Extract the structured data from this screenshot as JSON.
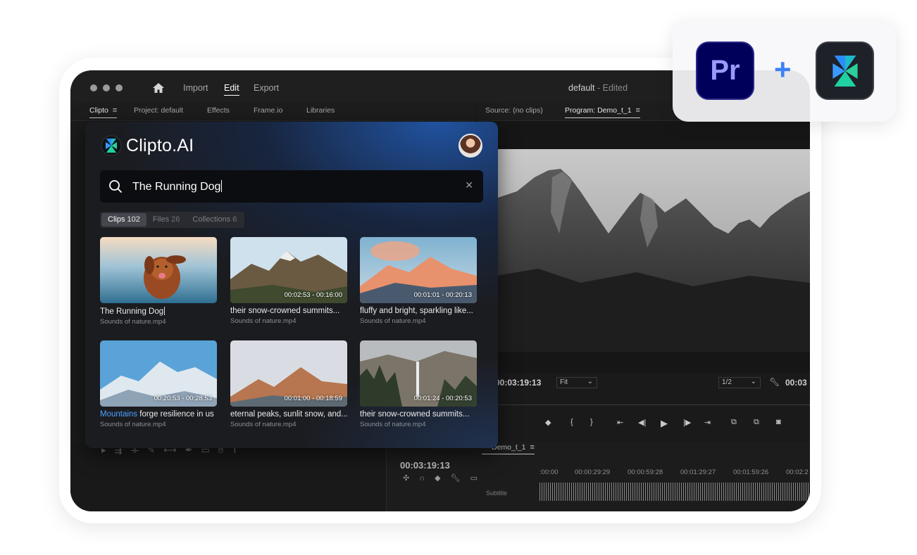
{
  "window": {
    "menu": {
      "import": "Import",
      "edit": "Edit",
      "export": "Export"
    },
    "doc_title": "default",
    "doc_status": " - Edited"
  },
  "panels": {
    "left_tabs": [
      "Clipto",
      "Project: default",
      "Effects",
      "Frame.io",
      "Libraries"
    ],
    "right_tabs": [
      "Source: (no clips)",
      "Program: Demo_t_1"
    ]
  },
  "monitor": {
    "timecode": "00:03:19:13",
    "fit": "Fit",
    "resolution": "1/2",
    "timecode_right": "00:03"
  },
  "timeline": {
    "sequence": "Demo_t_1",
    "timecode": "00:03:19:13",
    "ticks": [
      ":00:00",
      "00:00:29:29",
      "00:00:59:28",
      "00:01:29:27",
      "00:01:59:26",
      "00:02:2"
    ],
    "subtitle_label": "Subtitle"
  },
  "clipto": {
    "brand": "Clipto.AI",
    "search_query": "The Running Dog",
    "tabs": [
      {
        "label": "Clips",
        "count": "102"
      },
      {
        "label": "Files",
        "count": "26"
      },
      {
        "label": "Collections",
        "count": "6"
      }
    ],
    "clips": [
      {
        "title": "The Running Dog",
        "file": "Sounds of nature.mp4",
        "duration": ""
      },
      {
        "title": "their snow-crowned summits...",
        "file": "Sounds of nature.mp4",
        "duration": "00:02:53 - 00:16:00"
      },
      {
        "title": "fluffy and bright, sparkling like...",
        "file": "Sounds of nature.mp4",
        "duration": "00:01:01 - 00:20:13"
      },
      {
        "title_highlight": "Mountains",
        "title_rest": " forge resilience in us",
        "file": "Sounds of nature.mp4",
        "duration": "00:20:53 - 00:28:53"
      },
      {
        "title": "eternal peaks, sunlit snow, and...",
        "file": "Sounds of nature.mp4",
        "duration": "00:01:00 - 00:18:59"
      },
      {
        "title": "their snow-crowned summits...",
        "file": "Sounds of nature.mp4",
        "duration": "00:01:24 - 00:20:53"
      }
    ]
  },
  "badges": {
    "premiere_label": "Pr",
    "plus": "+"
  },
  "colors": {
    "accent_blue": "#4ea1ff",
    "premiere_bg": "#00005b",
    "premiere_fg": "#9999ff"
  }
}
